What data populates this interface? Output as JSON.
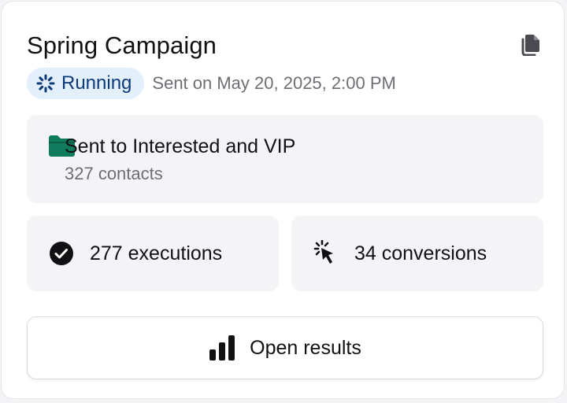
{
  "campaign": {
    "title": "Spring Campaign",
    "status_label": "Running",
    "sent_on": "Sent on May 20, 2025, 2:00 PM"
  },
  "audience": {
    "prefix": "Sent to",
    "segment_1": "Interested",
    "conjunction": "and",
    "segment_2": "VIP",
    "contacts": "327 contacts"
  },
  "stats": {
    "executions": "277 executions",
    "conversions": "34 conversions"
  },
  "actions": {
    "open_results_label": "Open results"
  },
  "icons": {
    "copy": "copy-icon",
    "status": "spinner-icon",
    "audience": "folder-icon",
    "executions": "check-circle-icon",
    "conversions": "cursor-click-icon",
    "open_results": "bar-chart-icon"
  },
  "colors": {
    "status_badge_bg": "#e4effc",
    "status_text": "#0b3a78",
    "folder": "#0f7a5c",
    "muted_text": "#6e6e74",
    "panel_bg": "#f4f4f6"
  }
}
